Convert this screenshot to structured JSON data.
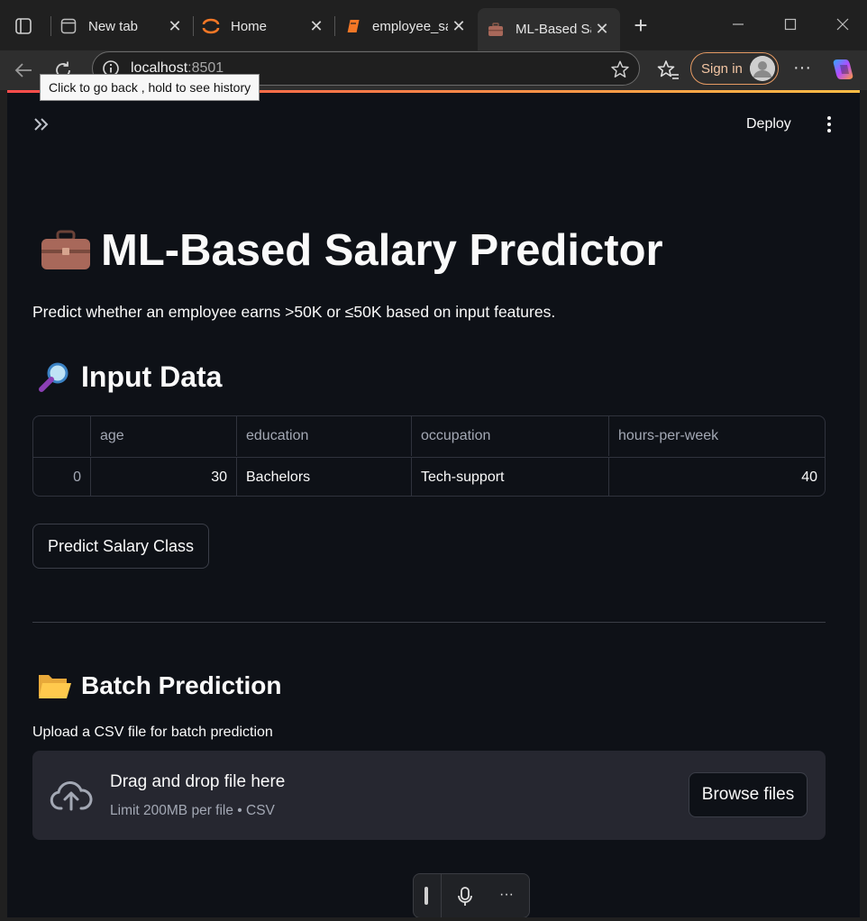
{
  "browser": {
    "tabs": [
      {
        "title": "New tab",
        "icon": "new-tab-page-icon"
      },
      {
        "title": "Home",
        "icon": "jupyter-icon"
      },
      {
        "title": "employee_sa",
        "icon": "notebook-icon"
      },
      {
        "title": "ML-Based Sa",
        "icon": "briefcase-icon",
        "active": true
      }
    ],
    "url_host": "localhost",
    "url_port": ":8501",
    "sign_in_label": "Sign in",
    "tooltip": "Click to go back , hold to see history"
  },
  "app": {
    "deploy_label": "Deploy",
    "title": "ML-Based Salary Predictor",
    "subtitle": "Predict whether an employee earns >50K or ≤50K based on input features.",
    "input_heading": "Input Data",
    "table": {
      "columns": [
        "",
        "age",
        "education",
        "occupation",
        "hours-per-week"
      ],
      "rows": [
        {
          "index": "0",
          "age": "30",
          "education": "Bachelors",
          "occupation": "Tech-support",
          "hours": "40"
        }
      ]
    },
    "predict_button": "Predict Salary Class",
    "batch_heading": "Batch Prediction",
    "upload_label": "Upload a CSV file for batch prediction",
    "dropzone": {
      "title": "Drag and drop file here",
      "limit": "Limit 200MB per file • CSV",
      "browse_button": "Browse files"
    }
  },
  "colors": {
    "background": "#0e1117",
    "secondary_background": "#262730",
    "text": "#fafafa",
    "accent_start": "#ff4b4b",
    "accent_end": "#ffbd45"
  }
}
